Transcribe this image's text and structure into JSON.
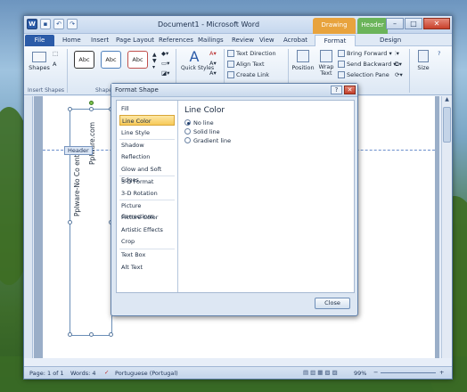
{
  "window": {
    "title": "Document1 - Microsoft Word",
    "context_tabs": {
      "drawing_tools": "Drawing Tools",
      "header": "Header ..."
    }
  },
  "tabs": [
    "File",
    "Home",
    "Insert",
    "Page Layout",
    "References",
    "Mailings",
    "Review",
    "View",
    "Acrobat",
    "Format",
    "Design"
  ],
  "ribbon": {
    "shapes_label": "Shapes",
    "insert_shapes_group": "Insert Shapes",
    "shape_styles_group": "Shape St...",
    "style_samples": [
      "Abc",
      "Abc",
      "Abc"
    ],
    "quick_styles": "Quick Styles",
    "text_direction": "Text Direction",
    "align_text": "Align Text",
    "create_link": "Create Link",
    "position": "Position",
    "wrap_text": "Wrap Text",
    "bring_forward": "Bring Forward",
    "send_backward": "Send Backward",
    "selection_pane": "Selection Pane",
    "size": "Size"
  },
  "document": {
    "vertical_text_1": "Pplware-No Co  ents",
    "vertical_text_2": "Pplware.com",
    "header_tag": "Header"
  },
  "dialog": {
    "title": "Format Shape",
    "help": "?",
    "nav_items": [
      "Fill",
      "Line Color",
      "Line Style",
      "Shadow",
      "Reflection",
      "Glow and Soft Edges",
      "3-D Format",
      "3-D Rotation",
      "Picture Corrections",
      "Picture Color",
      "Artistic Effects",
      "Crop",
      "Text Box",
      "Alt Text"
    ],
    "selected_item": "Line Color",
    "panel_title": "Line Color",
    "options": [
      "No line",
      "Solid line",
      "Gradient line"
    ],
    "selected_option": "No line",
    "close_button": "Close"
  },
  "statusbar": {
    "page": "Page: 1 of 1",
    "words": "Words: 4",
    "language": "Portuguese (Portugal)",
    "zoom": "99%"
  }
}
